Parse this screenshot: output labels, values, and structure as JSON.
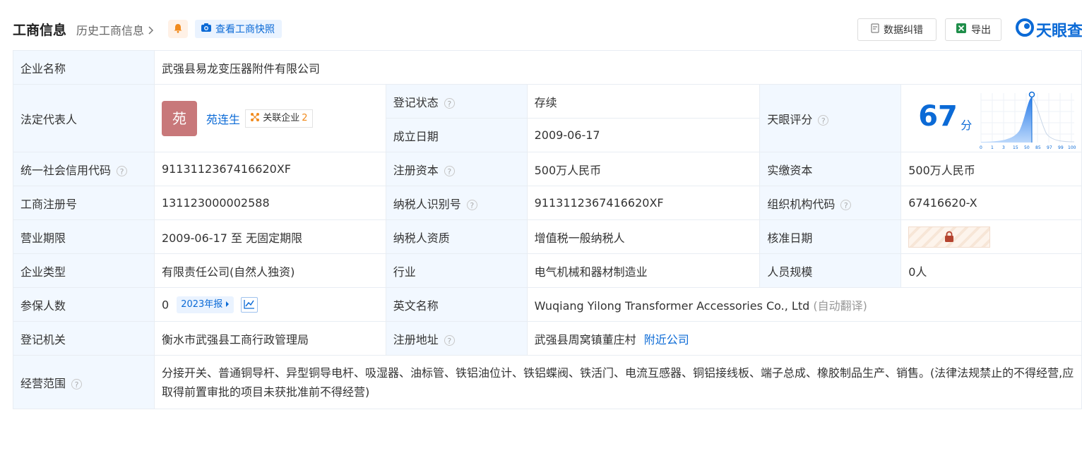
{
  "header": {
    "title": "工商信息",
    "history_link": "历史工商信息",
    "snapshot_label": "查看工商快照",
    "correct_label": "数据纠错",
    "export_label": "导出",
    "brand_label": "天眼查"
  },
  "company_name_label": "企业名称",
  "company_name_value": "武强县易龙变压器附件有限公司",
  "legal_rep": {
    "label": "法定代表人",
    "avatar_char": "苑",
    "name": "苑连生",
    "related_label": "关联企业",
    "related_count": "2"
  },
  "registration_status": {
    "label": "登记状态",
    "value": "存续"
  },
  "established_date": {
    "label": "成立日期",
    "value": "2009-06-17"
  },
  "tianyan_score": {
    "label": "天眼评分",
    "value": "67",
    "unit": "分",
    "ticks": [
      "0",
      "1",
      "3",
      "15",
      "50",
      "85",
      "97",
      "99",
      "100"
    ]
  },
  "credit_code": {
    "label": "统一社会信用代码",
    "value": "9113112367416620XF"
  },
  "registered_capital": {
    "label": "注册资本",
    "value": "500万人民币"
  },
  "paid_capital": {
    "label": "实缴资本",
    "value": "500万人民币"
  },
  "reg_number": {
    "label": "工商注册号",
    "value": "131123000002588"
  },
  "taxpayer_id": {
    "label": "纳税人识别号",
    "value": "9113112367416620XF"
  },
  "org_code": {
    "label": "组织机构代码",
    "value": "67416620-X"
  },
  "business_term": {
    "label": "营业期限",
    "value": "2009-06-17 至 无固定期限"
  },
  "taxpayer_qualification": {
    "label": "纳税人资质",
    "value": "增值税一般纳税人"
  },
  "approval_date": {
    "label": "核准日期"
  },
  "company_type": {
    "label": "企业类型",
    "value": "有限责任公司(自然人独资)"
  },
  "industry": {
    "label": "行业",
    "value": "电气机械和器材制造业"
  },
  "staff_size": {
    "label": "人员规模",
    "value": "0人"
  },
  "insured_count": {
    "label": "参保人数",
    "value": "0",
    "report_tag": "2023年报"
  },
  "english_name": {
    "label": "英文名称",
    "value": "Wuqiang Yilong Transformer Accessories Co., Ltd",
    "note": "(自动翻译)"
  },
  "registration_authority": {
    "label": "登记机关",
    "value": "衡水市武强县工商行政管理局"
  },
  "registered_address": {
    "label": "注册地址",
    "value": "武强县周窝镇董庄村",
    "nearby_link": "附近公司"
  },
  "business_scope": {
    "label": "经营范围",
    "value": "分接开关、普通铜导杆、异型铜导电杆、吸湿器、油标管、铁铝油位计、铁铝蝶阀、铁活门、电流互感器、铜铝接线板、端子总成、橡胶制品生产、销售。(法律法规禁止的不得经营,应取得前置审批的项目未获批准前不得经营)"
  },
  "colors": {
    "accent": "#0b6ad6",
    "label_bg": "#f2f8ff",
    "status_green": "#19a15f",
    "avatar": "#c8787a"
  },
  "icons": [
    "bell-icon",
    "camera-icon",
    "chevron-right-icon",
    "question-icon",
    "relation-icon",
    "trend-chart-icon",
    "lock-icon",
    "report-icon",
    "excel-icon",
    "brand-logo-icon"
  ]
}
